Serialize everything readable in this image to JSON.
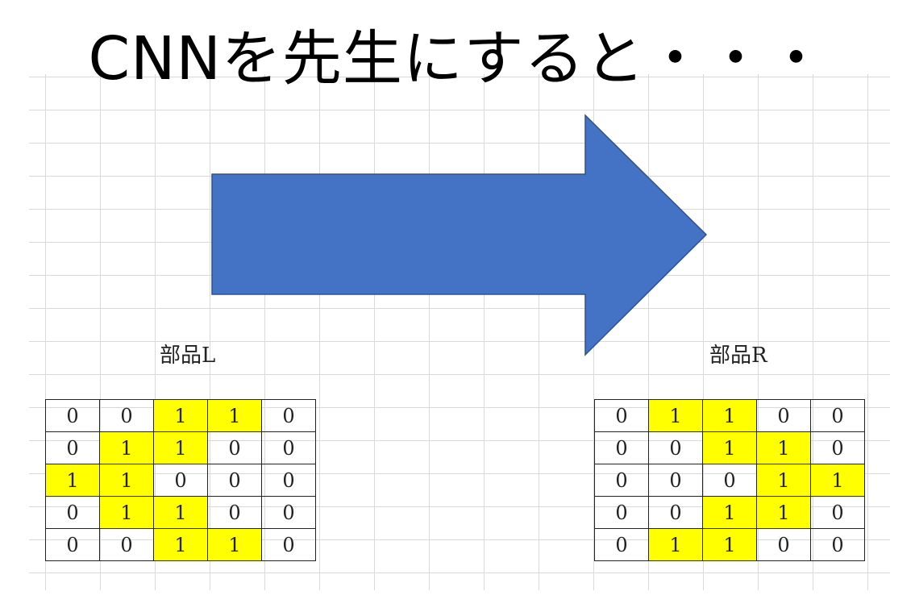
{
  "title": "CNNを先生にすると・・・",
  "left_part": {
    "label": "部品L",
    "rows": [
      [
        "0",
        "0",
        "1",
        "1",
        "0"
      ],
      [
        "0",
        "1",
        "1",
        "0",
        "0"
      ],
      [
        "1",
        "1",
        "0",
        "0",
        "0"
      ],
      [
        "0",
        "1",
        "1",
        "0",
        "0"
      ],
      [
        "0",
        "0",
        "1",
        "1",
        "0"
      ]
    ]
  },
  "right_part": {
    "label": "部品R",
    "rows": [
      [
        "0",
        "1",
        "1",
        "0",
        "0"
      ],
      [
        "0",
        "0",
        "1",
        "1",
        "0"
      ],
      [
        "0",
        "0",
        "0",
        "1",
        "1"
      ],
      [
        "0",
        "0",
        "1",
        "1",
        "0"
      ],
      [
        "0",
        "1",
        "1",
        "0",
        "0"
      ]
    ]
  },
  "colors": {
    "highlight": "#ffff00",
    "arrow_fill": "#4472c4",
    "arrow_stroke": "#2f528f",
    "gridline": "#d9d9d9"
  }
}
